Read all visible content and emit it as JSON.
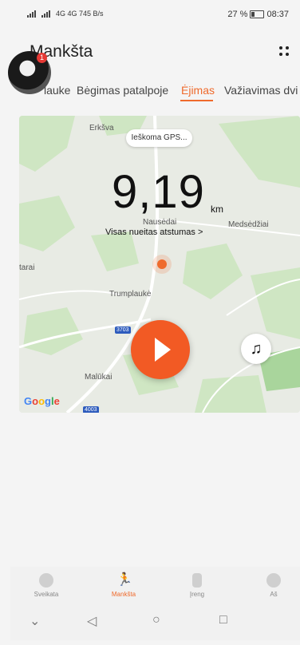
{
  "status": {
    "left": "4G 4G 745 B/s",
    "battery": "27 %",
    "time": "08:37"
  },
  "header": {
    "title": "Mankšta",
    "badge": "1"
  },
  "tabs": [
    "lauke",
    "Bėgimas patalpoje",
    "Ėjimas",
    "Važiavimas dvi"
  ],
  "map": {
    "gps_status": "Ieškoma GPS...",
    "distance": "9,19",
    "unit": "km",
    "distance_label": "Visas nueitas atstumas >",
    "places": [
      "Erkšva",
      "Nausėdai",
      "Medsėdžiai",
      "tarai",
      "Trumplaukė",
      "Malūkai"
    ],
    "roads": [
      "3703",
      "4003"
    ],
    "attribution": "Google"
  },
  "bottom_nav": [
    {
      "label": "Sveikata",
      "icon": "heart-icon"
    },
    {
      "label": "Mankšta",
      "icon": "running-icon",
      "active": true
    },
    {
      "label": "Įreng",
      "icon": "watch-icon"
    },
    {
      "label": "Aš",
      "icon": "user-icon"
    }
  ],
  "colors": {
    "accent": "#ef6a2c",
    "play": "#f25a24"
  }
}
